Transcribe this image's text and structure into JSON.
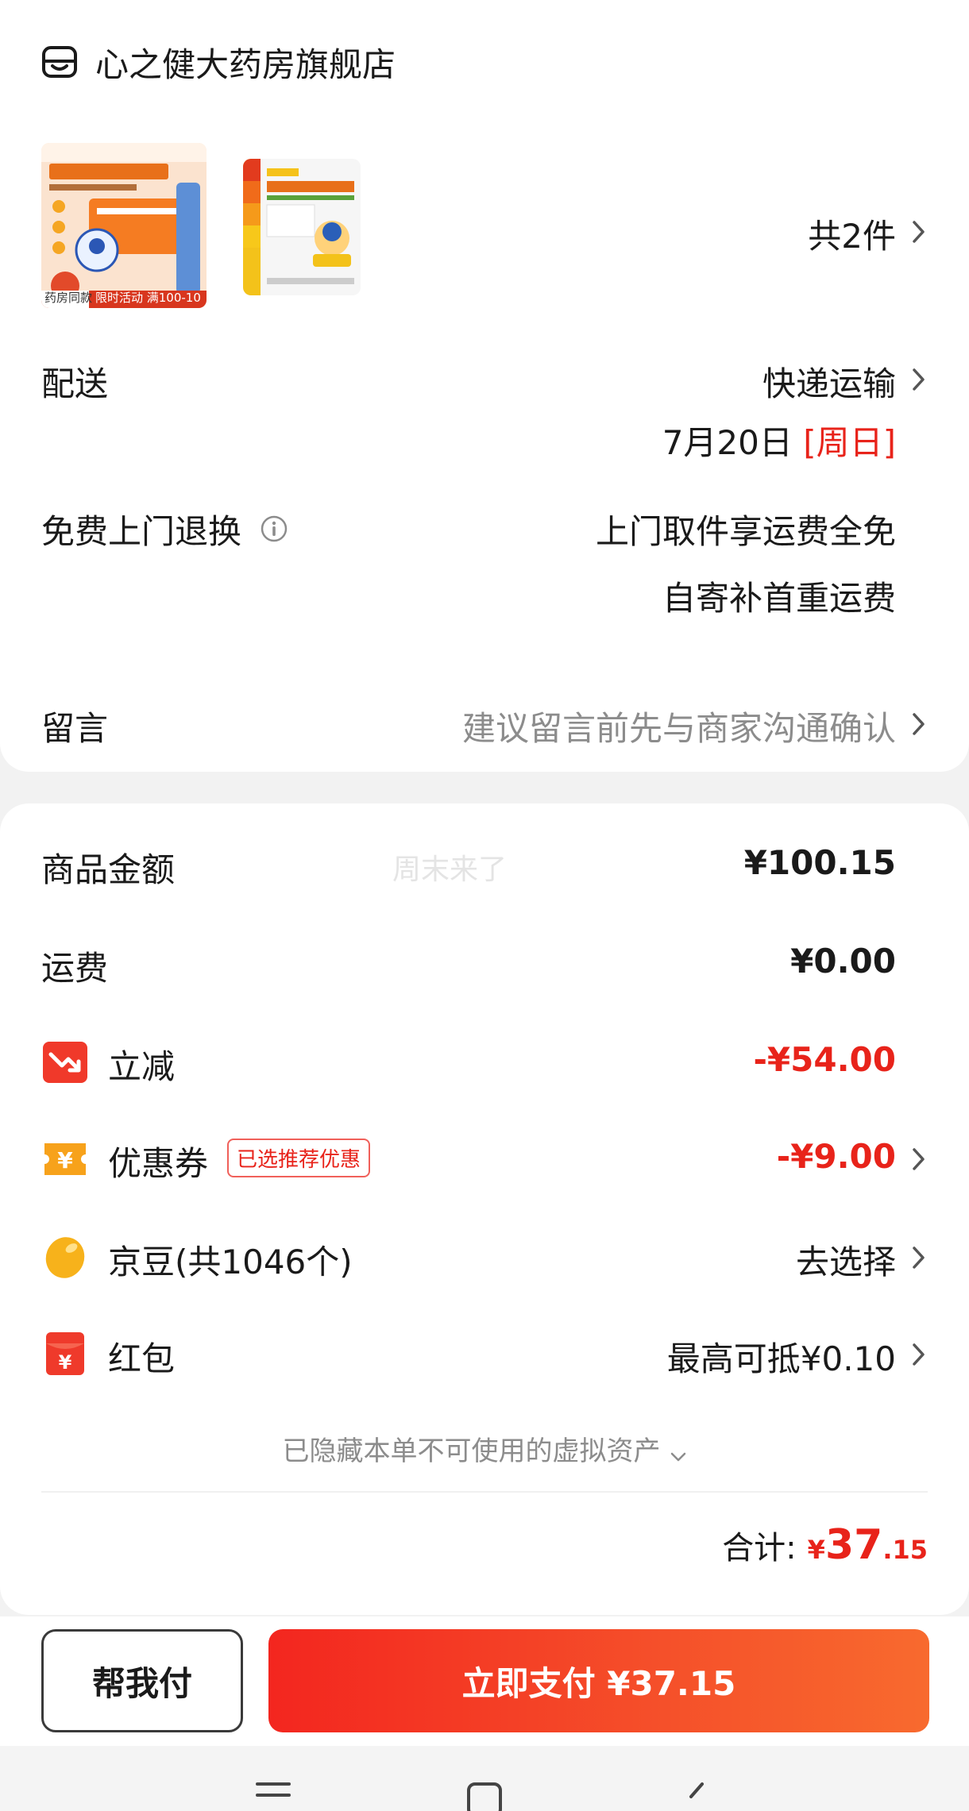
{
  "store": {
    "name": "心之健大药房旗舰店",
    "item_count": "共2件"
  },
  "products": [
    {
      "icon": "product-image-zinc-calcium-solution-orange",
      "promo_label": "限时活动 满100-10",
      "tag": "药房同款"
    },
    {
      "icon": "product-image-zinc-calcium-solution-box"
    }
  ],
  "delivery": {
    "label": "配送",
    "method": "快递运输",
    "date": "7月20日",
    "weekday": "[周日]"
  },
  "returns": {
    "label": "免费上门退换",
    "line1": "上门取件享运费全免",
    "line2": "自寄补首重运费"
  },
  "message": {
    "label": "留言",
    "placeholder": "建议留言前先与商家沟通确认"
  },
  "pricing": {
    "watermark": "周末来了",
    "goods_label": "商品金额",
    "goods_value": "¥100.15",
    "shipping_label": "运费",
    "shipping_value": "¥0.00",
    "discount_label": "立减",
    "discount_value": "-¥54.00",
    "coupon_label": "优惠券",
    "coupon_badge": "已选推荐优惠",
    "coupon_value": "-¥9.00",
    "beans_label": "京豆(共1046个)",
    "beans_value": "去选择",
    "redpacket_label": "红包",
    "redpacket_value": "最高可抵¥0.10",
    "hidden_assets": "已隐藏本单不可使用的虚拟资产",
    "total_label": "合计:",
    "total_currency": "¥",
    "total_integer": "37",
    "total_decimal": ".15"
  },
  "actions": {
    "help_pay": "帮我付",
    "pay_now": "立即支付 ¥37.15"
  },
  "colors": {
    "accent_red": "#e8231a",
    "muted_gray": "#8c8c8c"
  },
  "icons": {
    "store": "store-icon",
    "info": "info-icon",
    "discount": "discount-arrow-icon",
    "coupon": "coupon-yen-icon",
    "beans": "jd-bean-icon",
    "redpacket": "red-packet-icon",
    "menu": "nav-menu-icon",
    "home": "nav-home-icon",
    "back": "nav-back-icon"
  }
}
